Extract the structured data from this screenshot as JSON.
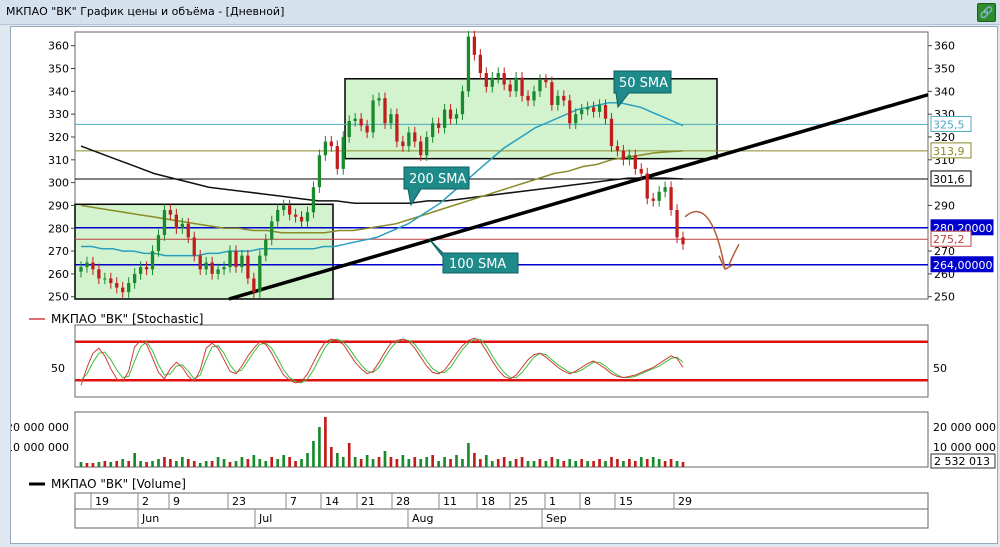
{
  "window": {
    "title": "МКПАО \"ВК\" График цены и объёма - [Дневной]",
    "corner_icon": "link-icon"
  },
  "price_panel": {
    "y_ticks": [
      "360",
      "350",
      "340",
      "330",
      "320",
      "310",
      "300",
      "290",
      "280",
      "270",
      "260",
      "250"
    ],
    "right_ticks": [
      "360",
      "350",
      "340",
      "330",
      "320",
      "310",
      "290",
      "270",
      "260",
      "250"
    ],
    "annotations": {
      "sma50": "50 SMA",
      "sma200": "200 SMA",
      "sma100": "100 SMA"
    },
    "price_tags": [
      {
        "label": "325,5",
        "value": 325.5,
        "color": "#4aa8c0",
        "style": "outline"
      },
      {
        "label": "313,9",
        "value": 313.9,
        "color": "#8a8a2a",
        "style": "outline"
      },
      {
        "label": "301,6",
        "value": 301.6,
        "color": "#000000",
        "style": "outline"
      },
      {
        "label": "280,20000",
        "value": 280.2,
        "color": "#0000cc",
        "style": "filled"
      },
      {
        "label": "275,2",
        "value": 275.2,
        "color": "#c04040",
        "style": "outline"
      },
      {
        "label": "264,00000",
        "value": 264.0,
        "color": "#0000cc",
        "style": "filled"
      }
    ]
  },
  "stoch_panel": {
    "legend": "МКПАО \"ВК\" [Stochastic]",
    "tick": "50"
  },
  "volume_panel": {
    "left_ticks": [
      "20 000 000",
      "10 000 000"
    ],
    "right_ticks": [
      "20 000 000",
      "10 000 000"
    ],
    "last_value": "2 532 013",
    "legend": "МКПАО \"ВК\" [Volume]"
  },
  "date_axis": {
    "days": [
      "19",
      "2",
      "9",
      "23",
      "7",
      "14",
      "21",
      "28",
      "11",
      "18",
      "25",
      "1",
      "8",
      "15",
      "29"
    ],
    "months": [
      "Jun",
      "Jul",
      "Aug",
      "Sep"
    ]
  },
  "chart_data": {
    "type": "candlestick",
    "title": "",
    "y_range": [
      249,
      366
    ],
    "closes": [
      263,
      265,
      262,
      258,
      258,
      256,
      254,
      252,
      256,
      260,
      263,
      262,
      270,
      277,
      288,
      286,
      280,
      282,
      276,
      268,
      262,
      265,
      260,
      262,
      263,
      270,
      263,
      268,
      258,
      252,
      268,
      275,
      283,
      288,
      290,
      286,
      285,
      283,
      287,
      298,
      312,
      318,
      316,
      306,
      320,
      327,
      328,
      325,
      322,
      336,
      337,
      326,
      330,
      318,
      316,
      322,
      318,
      312,
      320,
      326,
      324,
      332,
      328,
      330,
      340,
      364,
      356,
      348,
      342,
      346,
      348,
      343,
      340,
      346,
      338,
      336,
      340,
      345,
      344,
      334,
      338,
      336,
      326,
      330,
      332,
      333,
      331,
      334,
      328,
      316,
      314,
      310,
      312,
      306,
      304,
      293,
      292,
      296,
      298,
      288,
      276,
      273
    ],
    "sma50": [
      272,
      272,
      271,
      271,
      270,
      270,
      269,
      269,
      268,
      268,
      268,
      268,
      269,
      269,
      270,
      270,
      270,
      271,
      271,
      271,
      271,
      271,
      271,
      272,
      272,
      273,
      274,
      275,
      276,
      278,
      280,
      282,
      285,
      288,
      291,
      295,
      299,
      303,
      307,
      311,
      315,
      318,
      321,
      324,
      326,
      328,
      330,
      332,
      333,
      334,
      335,
      335,
      334,
      333,
      331,
      329,
      327,
      325
    ],
    "sma100": [
      290,
      289,
      288,
      287,
      286,
      285,
      284,
      283,
      282,
      281,
      280,
      280,
      279,
      279,
      278,
      278,
      278,
      278,
      279,
      279,
      280,
      281,
      282,
      284,
      286,
      288,
      290,
      292,
      294,
      296,
      298,
      300,
      302,
      304,
      305,
      307,
      308,
      310,
      311,
      312,
      313,
      313.5,
      313.9
    ],
    "sma200": [
      316,
      313,
      310,
      307,
      304,
      302,
      300,
      298,
      297,
      296,
      295,
      294,
      293,
      292,
      292,
      291,
      291,
      291,
      291,
      292,
      292,
      293,
      294,
      295,
      296,
      297,
      298,
      299,
      300,
      301,
      302,
      302,
      302,
      301.6
    ],
    "stochastic": [
      12,
      40,
      62,
      70,
      58,
      38,
      22,
      18,
      34,
      72,
      82,
      76,
      55,
      32,
      22,
      38,
      48,
      40,
      26,
      18,
      36,
      70,
      78,
      70,
      52,
      34,
      30,
      42,
      58,
      70,
      80,
      76,
      62,
      44,
      28,
      20,
      16,
      18,
      30,
      48,
      66,
      80,
      84,
      82,
      76,
      62,
      48,
      38,
      30,
      34,
      48,
      64,
      78,
      82,
      84,
      80,
      70,
      56,
      42,
      32,
      30,
      36,
      48,
      62,
      74,
      82,
      86,
      80,
      66,
      50,
      36,
      26,
      22,
      28,
      40,
      52,
      60,
      62,
      56,
      48,
      40,
      34,
      30,
      34,
      40,
      46,
      50,
      44,
      38,
      30,
      26,
      24,
      26,
      28,
      32,
      36,
      40,
      46,
      52,
      58,
      54,
      40
    ],
    "stoch_signal": [
      20,
      30,
      48,
      62,
      64,
      52,
      36,
      24,
      26,
      50,
      72,
      80,
      66,
      44,
      28,
      30,
      42,
      44,
      34,
      22,
      28,
      52,
      72,
      74,
      62,
      44,
      32,
      36,
      50,
      64,
      76,
      78,
      70,
      54,
      36,
      24,
      18,
      16,
      22,
      36,
      54,
      72,
      82,
      84,
      80,
      70,
      56,
      44,
      34,
      32,
      40,
      56,
      70,
      80,
      84,
      82,
      76,
      64,
      50,
      38,
      32,
      32,
      40,
      54,
      68,
      78,
      84,
      84,
      74,
      58,
      44,
      32,
      24,
      24,
      32,
      44,
      56,
      62,
      60,
      52,
      44,
      38,
      32,
      32,
      36,
      42,
      48,
      48,
      42,
      34,
      28,
      24,
      24,
      26,
      30,
      34,
      38,
      42,
      48,
      54,
      56,
      48
    ],
    "volume": [
      2.5,
      2,
      2,
      2.5,
      3,
      2.5,
      3,
      4,
      3,
      7,
      3,
      2.5,
      3,
      4,
      5,
      4,
      3,
      5,
      4,
      3,
      2,
      3,
      3,
      5,
      4,
      2.5,
      3,
      5,
      4,
      6,
      4,
      3,
      5,
      4,
      6,
      5,
      3,
      4,
      7,
      13,
      20,
      25,
      10,
      7,
      5,
      12,
      5,
      4,
      6,
      4,
      5,
      8,
      5,
      4,
      6,
      4,
      5,
      4,
      5,
      6,
      3,
      5,
      4,
      6,
      4,
      12,
      7,
      4,
      6,
      3,
      4,
      5,
      3,
      4,
      5,
      3,
      3,
      4,
      3,
      5,
      4,
      3,
      4,
      3,
      4,
      3,
      3,
      4,
      3,
      5,
      4,
      3,
      4,
      3,
      5,
      4,
      5,
      4,
      3,
      4,
      3,
      2.5
    ],
    "volume_up": [
      1,
      0,
      0,
      1,
      0,
      1,
      0,
      1,
      0,
      1,
      1,
      0,
      1,
      1,
      0,
      0,
      1,
      1,
      0,
      0,
      1,
      1,
      0,
      1,
      1,
      0,
      1,
      1,
      0,
      1,
      1,
      1,
      0,
      1,
      1,
      0,
      0,
      1,
      1,
      1,
      1,
      0,
      0,
      1,
      1,
      0,
      1,
      0,
      1,
      1,
      0,
      1,
      0,
      0,
      1,
      1,
      0,
      1,
      1,
      0,
      1,
      1,
      0,
      1,
      1,
      1,
      0,
      0,
      1,
      1,
      0,
      0,
      1,
      0,
      0,
      1,
      1,
      0,
      1,
      0,
      1,
      0,
      1,
      1,
      0,
      1,
      0,
      0,
      1,
      0,
      0,
      1,
      0,
      0,
      1,
      0,
      1,
      1,
      0,
      0,
      1,
      0
    ]
  }
}
